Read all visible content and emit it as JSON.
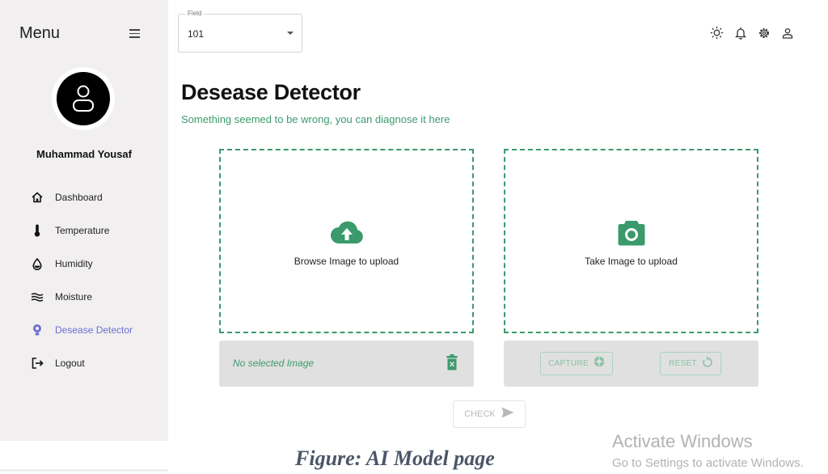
{
  "sidebar": {
    "menu_title": "Menu",
    "user_name": "Muhammad Yousaf",
    "items": [
      {
        "label": "Dashboard",
        "icon": "home-icon"
      },
      {
        "label": "Temperature",
        "icon": "thermometer-icon"
      },
      {
        "label": "Humidity",
        "icon": "droplet-icon"
      },
      {
        "label": "Moisture",
        "icon": "waves-icon"
      },
      {
        "label": "Desease Detector",
        "icon": "bulb-icon",
        "active": true
      },
      {
        "label": "Logout",
        "icon": "logout-icon"
      }
    ]
  },
  "header": {
    "field_label": "Field",
    "field_value": "101",
    "icons": [
      "sun-icon",
      "bell-icon",
      "gear-icon",
      "user-icon"
    ]
  },
  "main": {
    "title": "Desease Detector",
    "subtitle": "Something seemed to be wrong, you can diagnose it here",
    "browse_label": "Browse Image to upload",
    "take_label": "Take Image to upload",
    "no_image_text": "No selected Image",
    "capture_label": "CAPTURE",
    "reset_label": "RESET",
    "check_label": "CHECK"
  },
  "caption": "Figure: AI Model page",
  "watermark": {
    "title": "Activate Windows",
    "subtitle": "Go to Settings to activate Windows."
  },
  "colors": {
    "accent_green": "#3d9a6f",
    "active_nav": "#6a6fd3",
    "sidebar_bg": "#f1efef"
  }
}
